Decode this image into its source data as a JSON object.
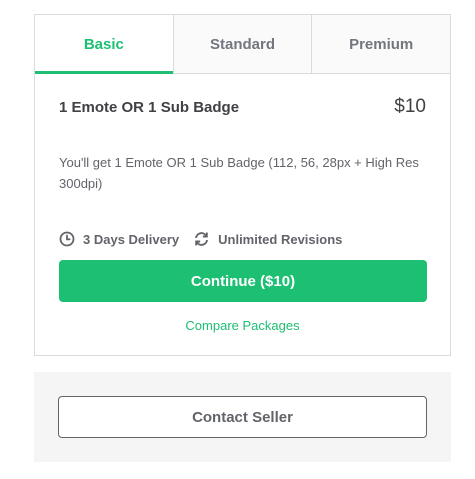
{
  "tabs": [
    {
      "label": "Basic"
    },
    {
      "label": "Standard"
    },
    {
      "label": "Premium"
    }
  ],
  "package": {
    "title": "1 Emote OR 1 Sub Badge",
    "price": "$10",
    "description": "You'll get 1 Emote OR 1 Sub Badge (112, 56, 28px + High Res 300dpi)",
    "delivery": "3 Days Delivery",
    "revisions": "Unlimited Revisions"
  },
  "actions": {
    "continue_label": "Continue ($10)",
    "compare_label": "Compare Packages",
    "contact_label": "Contact Seller"
  },
  "colors": {
    "accent": "#1dbf73",
    "text": "#404145",
    "muted": "#62646a"
  },
  "icons": {
    "delivery": "clock-icon",
    "revisions": "refresh-icon"
  }
}
